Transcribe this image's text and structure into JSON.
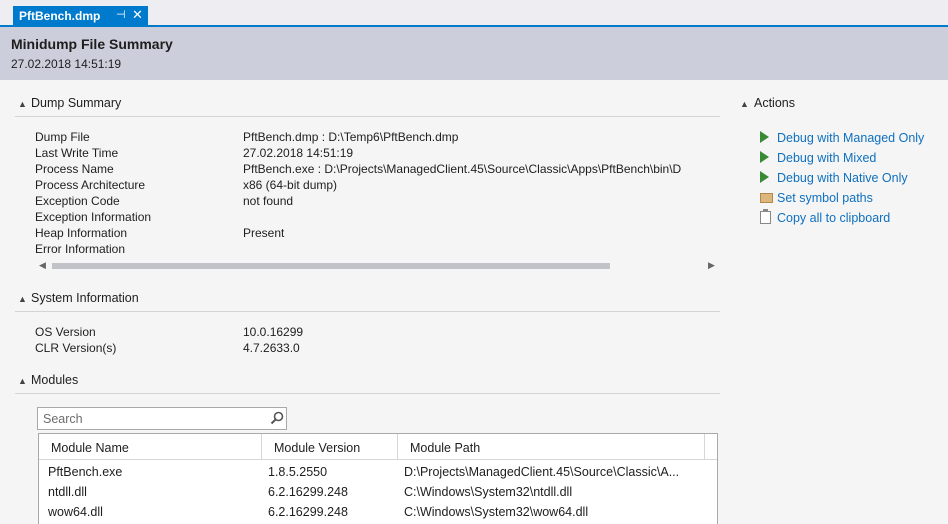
{
  "tab": {
    "label": "PftBench.dmp",
    "pin_glyph": "⊣",
    "close_glyph": "✕"
  },
  "header": {
    "title": "Minidump File Summary",
    "timestamp": "27.02.2018 14:51:19"
  },
  "dump_summary": {
    "heading": "Dump Summary",
    "rows": [
      {
        "label": "Dump File",
        "value": "PftBench.dmp : D:\\Temp6\\PftBench.dmp"
      },
      {
        "label": "Last Write Time",
        "value": "27.02.2018 14:51:19"
      },
      {
        "label": "Process Name",
        "value": "PftBench.exe : D:\\Projects\\ManagedClient.45\\Source\\Classic\\Apps\\PftBench\\bin\\D"
      },
      {
        "label": "Process Architecture",
        "value": "x86 (64-bit dump)"
      },
      {
        "label": "Exception Code",
        "value": "not found"
      },
      {
        "label": "Exception Information",
        "value": ""
      },
      {
        "label": "Heap Information",
        "value": "Present"
      },
      {
        "label": "Error Information",
        "value": ""
      }
    ]
  },
  "system_info": {
    "heading": "System Information",
    "rows": [
      {
        "label": "OS Version",
        "value": "10.0.16299"
      },
      {
        "label": "CLR Version(s)",
        "value": "4.7.2633.0"
      }
    ]
  },
  "modules": {
    "heading": "Modules",
    "search_placeholder": "Search",
    "columns": [
      "Module Name",
      "Module Version",
      "Module Path"
    ],
    "rows": [
      [
        "PftBench.exe",
        "1.8.5.2550",
        "D:\\Projects\\ManagedClient.45\\Source\\Classic\\A..."
      ],
      [
        "ntdll.dll",
        "6.2.16299.248",
        "C:\\Windows\\System32\\ntdll.dll"
      ],
      [
        "wow64.dll",
        "6.2.16299.248",
        "C:\\Windows\\System32\\wow64.dll"
      ]
    ]
  },
  "actions": {
    "heading": "Actions",
    "items": [
      {
        "label": "Debug with Managed Only",
        "icon": "play-icon"
      },
      {
        "label": "Debug with Mixed",
        "icon": "play-icon"
      },
      {
        "label": "Debug with Native Only",
        "icon": "play-icon"
      },
      {
        "label": "Set symbol paths",
        "icon": "folder-icon"
      },
      {
        "label": "Copy all to clipboard",
        "icon": "clipboard-icon"
      }
    ]
  },
  "colors": {
    "accent": "#007acc",
    "header_bg": "#cccedb",
    "link": "#0e70c0",
    "play": "#388a34"
  }
}
